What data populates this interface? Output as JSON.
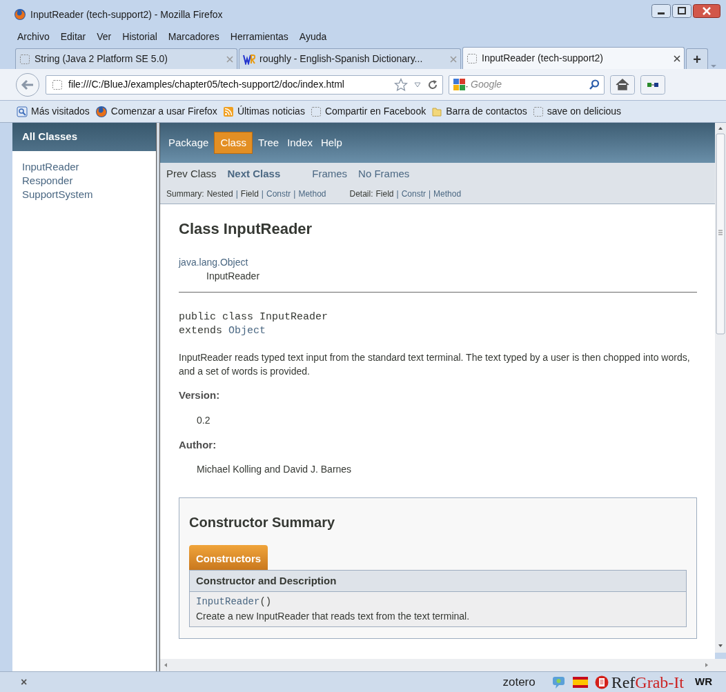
{
  "window": {
    "title": "InputReader (tech-support2) - Mozilla Firefox"
  },
  "menu": [
    {
      "label": "Archivo"
    },
    {
      "label": "Editar"
    },
    {
      "label": "Ver"
    },
    {
      "label": "Historial"
    },
    {
      "label": "Marcadores"
    },
    {
      "label": "Herramientas"
    },
    {
      "label": "Ayuda"
    }
  ],
  "tabs": [
    {
      "label": "String (Java 2 Platform SE 5.0)",
      "kind": "blank",
      "selected": false
    },
    {
      "label": "roughly - English-Spanish Dictionary...",
      "kind": "wr",
      "selected": false
    },
    {
      "label": "InputReader (tech-support2)",
      "kind": "blank",
      "selected": true
    }
  ],
  "new_tab": "+",
  "url": "file:///C:/BlueJ/examples/chapter05/tech-support2/doc/index.html",
  "search": {
    "placeholder": "Google"
  },
  "bookmarks": [
    {
      "label": "Más visitados",
      "kind": "visited"
    },
    {
      "label": "Comenzar a usar Firefox",
      "kind": "firefox"
    },
    {
      "label": "Últimas noticias",
      "kind": "rss"
    },
    {
      "label": "Compartir en Facebook",
      "kind": "blank"
    },
    {
      "label": "Barra de contactos",
      "kind": "folder"
    },
    {
      "label": "save on delicious",
      "kind": "blank"
    }
  ],
  "class_frame": {
    "heading": "All Classes",
    "items": [
      "InputReader",
      "Responder",
      "SupportSystem"
    ]
  },
  "top_nav": [
    {
      "label": "Package",
      "selected": false
    },
    {
      "label": "Class",
      "selected": true
    },
    {
      "label": "Tree",
      "selected": false
    },
    {
      "label": "Index",
      "selected": false
    },
    {
      "label": "Help",
      "selected": false
    }
  ],
  "sub_nav": [
    {
      "label": "Prev Class",
      "link": false
    },
    {
      "label": "Next Class",
      "link": true
    },
    {
      "label": "Frames",
      "link": true
    },
    {
      "label": "No Frames",
      "link": true
    }
  ],
  "summary": {
    "label": "Summary:",
    "items": [
      {
        "label": "Nested",
        "link": false
      },
      {
        "label": "Field",
        "link": false
      },
      {
        "label": "Constr",
        "link": true
      },
      {
        "label": "Method",
        "link": true
      }
    ]
  },
  "detail": {
    "label": "Detail:",
    "items": [
      {
        "label": "Field",
        "link": false
      },
      {
        "label": "Constr",
        "link": true
      },
      {
        "label": "Method",
        "link": true
      }
    ]
  },
  "separator": "|",
  "content": {
    "title": "Class InputReader",
    "hierarchy": [
      "java.lang.Object",
      "InputReader"
    ],
    "declaration": "public class InputReader",
    "extends_keyword": "extends",
    "extends_type": "Object",
    "description": "InputReader reads typed text input from the standard text terminal. The text typed by a user is then chopped into words, and a set of words is provided.",
    "tags": [
      {
        "label": "Version:",
        "value": "0.2"
      },
      {
        "label": "Author:",
        "value": "Michael Kolling and David J. Barnes"
      }
    ],
    "constructor_summary": {
      "title": "Constructor Summary",
      "tab": "Constructors",
      "column": "Constructor and Description",
      "rows": [
        {
          "name": "InputReader",
          "params": "()",
          "description": "Create a new InputReader that reads text from the text terminal."
        }
      ]
    }
  },
  "status": {
    "close": "×",
    "zotero": "zotero",
    "refgrab": [
      {
        "text": "Ref",
        "color": "#222222"
      },
      {
        "text": "Grab-It",
        "color": "#cc2222"
      }
    ],
    "wr": "WR"
  }
}
